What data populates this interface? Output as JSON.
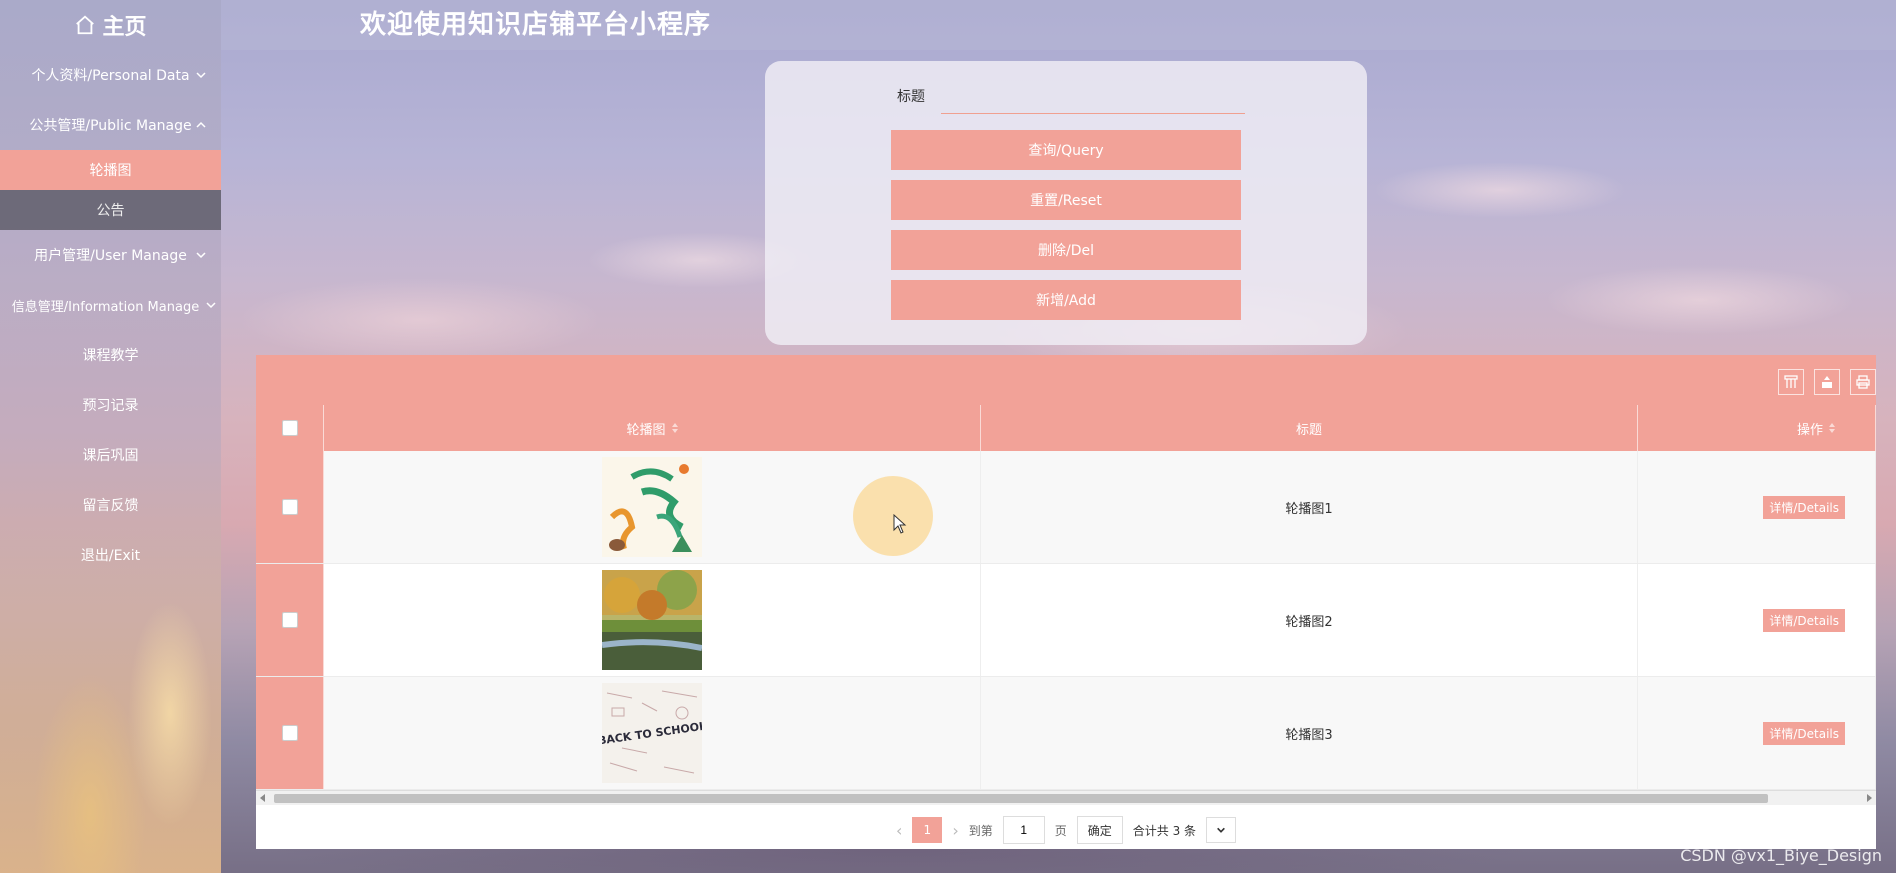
{
  "app": {
    "logo_label": "主页",
    "header_title": "欢迎使用知识店铺平台小程序"
  },
  "sidebar": {
    "items": [
      {
        "label": "个人资料/Personal Data",
        "type": "group",
        "expanded": false
      },
      {
        "label": "公共管理/Public Manage",
        "type": "group",
        "expanded": true
      },
      {
        "label": "轮播图",
        "type": "sub",
        "active": true
      },
      {
        "label": "公告",
        "type": "sub",
        "active": false
      },
      {
        "label": "用户管理/User Manage",
        "type": "group",
        "expanded": false
      },
      {
        "label": "信息管理/Information Manage",
        "type": "group",
        "expanded": false
      },
      {
        "label": "课程教学",
        "type": "link"
      },
      {
        "label": "预习记录",
        "type": "link"
      },
      {
        "label": "课后巩固",
        "type": "link"
      },
      {
        "label": "留言反馈",
        "type": "link"
      },
      {
        "label": "退出/Exit",
        "type": "link"
      }
    ]
  },
  "search": {
    "title_label": "标题",
    "title_value": "",
    "query_label": "查询/Query",
    "reset_label": "重置/Reset",
    "delete_label": "删除/Del",
    "add_label": "新增/Add"
  },
  "table": {
    "columns": [
      "轮播图",
      "标题",
      "操作"
    ],
    "rows": [
      {
        "image": "youth-poster",
        "title": "轮播图1",
        "action": "详情/Details"
      },
      {
        "image": "autumn-lake",
        "title": "轮播图2",
        "action": "详情/Details"
      },
      {
        "image": "back-to-school",
        "title": "轮播图3",
        "action": "详情/Details"
      }
    ]
  },
  "pager": {
    "current_page": "1",
    "goto_label": "到第",
    "goto_value": "1",
    "page_unit": "页",
    "confirm_label": "确定",
    "total_label": "合计共 3 条"
  },
  "watermark": "CSDN @vx1_Biye_Design",
  "colors": {
    "accent": "#f2a298"
  }
}
